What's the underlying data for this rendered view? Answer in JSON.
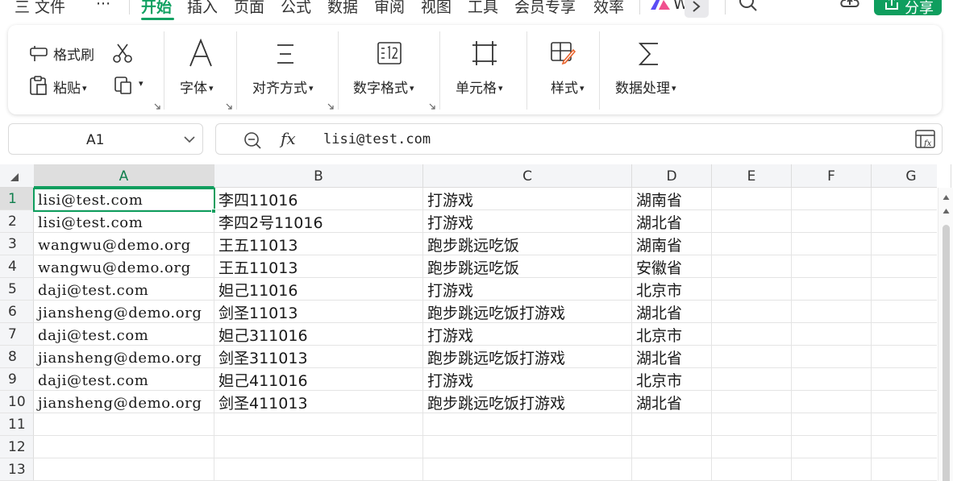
{
  "menu": {
    "items": [
      "三 文件",
      "···",
      "开始",
      "插入",
      "页面",
      "公式",
      "数据",
      "审阅",
      "视图",
      "工具",
      "会员专享",
      "效率"
    ],
    "active": "开始",
    "ai_label": "W",
    "share_label": "分享"
  },
  "ribbon": {
    "format_painter": "格式刷",
    "paste": "粘贴",
    "font": "字体",
    "align": "对齐方式",
    "number_format": "数字格式",
    "cell": "单元格",
    "style": "样式",
    "data_process": "数据处理"
  },
  "namebox": {
    "value": "A1"
  },
  "formula": {
    "fx": "fx",
    "value": "lisi@test.com"
  },
  "columns": [
    "A",
    "B",
    "C",
    "D",
    "E",
    "F",
    "G"
  ],
  "rows": [
    "1",
    "2",
    "3",
    "4",
    "5",
    "6",
    "7",
    "8",
    "9",
    "10",
    "11",
    "12",
    "13"
  ],
  "cells": [
    [
      "lisi@test.com",
      "李四11016",
      "打游戏",
      "湖南省"
    ],
    [
      "lisi@test.com",
      "李四2号11016",
      "打游戏",
      "湖北省"
    ],
    [
      "wangwu@demo.org",
      "王五11013",
      "跑步跳远吃饭",
      "湖南省"
    ],
    [
      "wangwu@demo.org",
      "王五11013",
      "跑步跳远吃饭",
      "安徽省"
    ],
    [
      "daji@test.com",
      "妲己11016",
      "打游戏",
      "北京市"
    ],
    [
      "jiansheng@demo.org",
      "剑圣11013",
      "跑步跳远吃饭打游戏",
      "湖北省"
    ],
    [
      "daji@test.com",
      "妲己311016",
      "打游戏",
      "北京市"
    ],
    [
      "jiansheng@demo.org",
      "剑圣311013",
      "跑步跳远吃饭打游戏",
      "湖北省"
    ],
    [
      "daji@test.com",
      "妲己411016",
      "打游戏",
      "北京市"
    ],
    [
      "jiansheng@demo.org",
      "剑圣411013",
      "跑步跳远吃饭打游戏",
      "湖北省"
    ]
  ],
  "colors": {
    "accent": "#0f9e5e",
    "header_bg": "#f4f5f7",
    "selected_header": "#dedede"
  }
}
